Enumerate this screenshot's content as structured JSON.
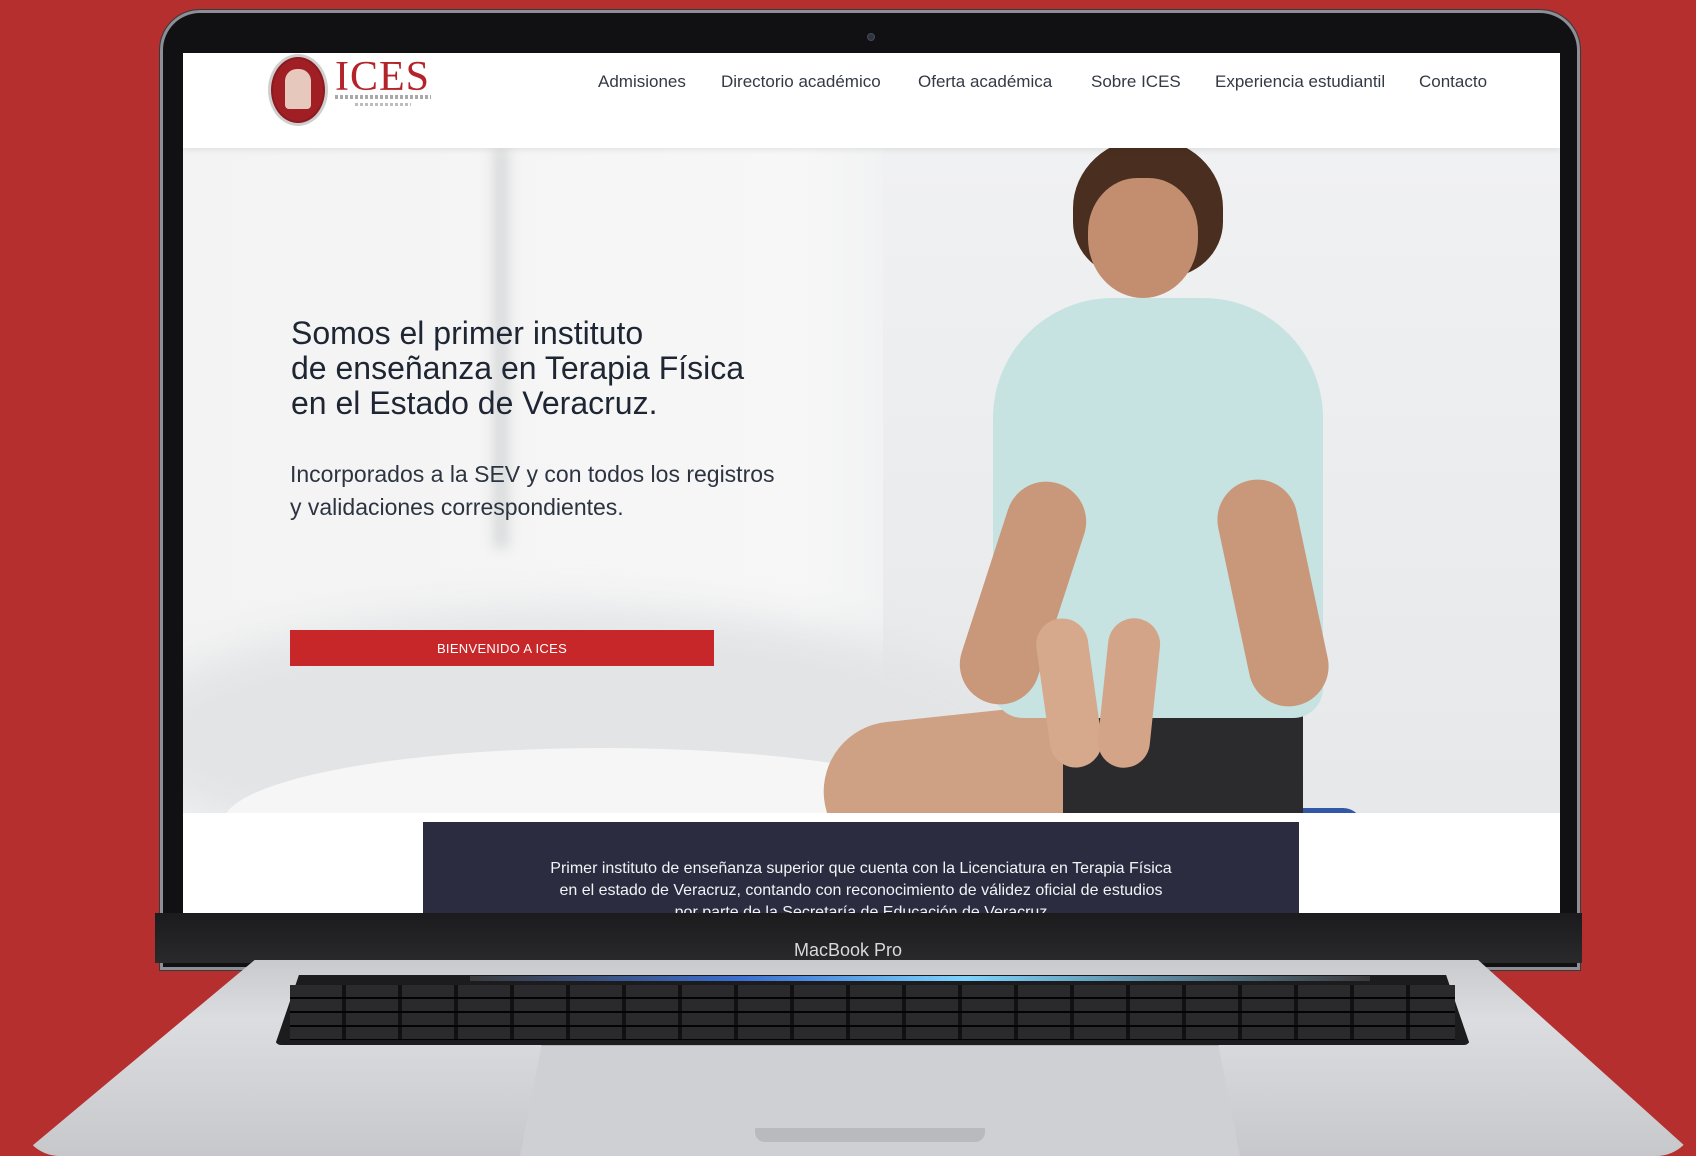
{
  "brand": {
    "logo_text": "ICES",
    "logo_subtitle": "Instituto Científico de Educación Superior",
    "device_label": "MacBook Pro"
  },
  "nav": {
    "items": [
      "Admisiones",
      "Directorio académico",
      "Oferta académica",
      "Sobre ICES",
      "Experiencia estudiantil",
      "Contacto"
    ]
  },
  "hero": {
    "title": "Somos el primer instituto\nde enseñanza en Terapia Física\nen el Estado de Veracruz.",
    "subtitle": "Incorporados a la SEV y con todos los registros\ny validaciones correspondientes.",
    "button_label": "BIENVENIDO A ICES"
  },
  "info": {
    "text": "Primer instituto de enseñanza superior que cuenta con la Licenciatura en Terapia Física\nen el estado de Veracruz, contando con reconocimiento de válidez oficial de estudios\npor parte de la Secretaría de Educación de Veracruz"
  },
  "colors": {
    "background": "#b52f2f",
    "accent": "#c8272a",
    "info_band": "#2b2c40"
  }
}
